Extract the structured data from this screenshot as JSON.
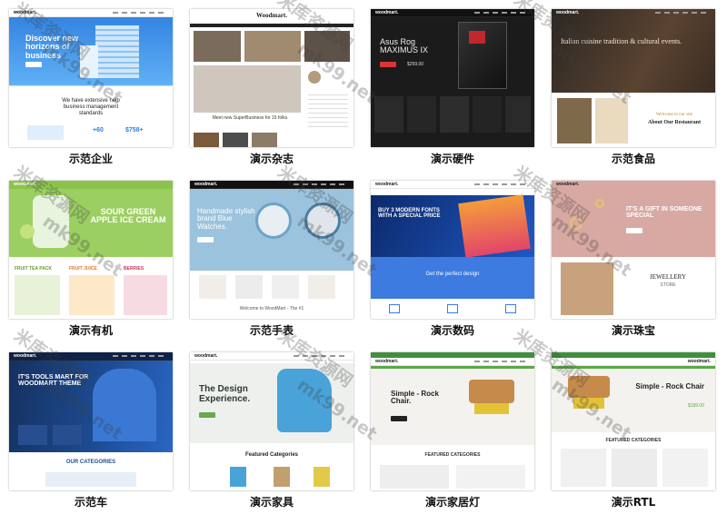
{
  "brand_name": "woodmart.",
  "demos": [
    {
      "caption": "示范企业",
      "hero_title": "Discover new horizons of business",
      "body_line": "We have extensive help business management standards",
      "stats": [
        "+60",
        "$758+"
      ]
    },
    {
      "caption": "演示杂志",
      "hero_title": "Woodmart.",
      "body_line": "Meet new SuperBusiness for 15 folks"
    },
    {
      "caption": "演示硬件",
      "hero_title": "Asus Rog MAXIMUS IX",
      "price": "$299.00"
    },
    {
      "caption": "示范食品",
      "hero_title": "Italian cuisine tradition & cultural events.",
      "sub_title": "Welcome to our site",
      "body_line": "About Our Restaurant"
    },
    {
      "caption": "演示有机",
      "hero_title": "SOUR GREEN APPLE ICE CREAM",
      "products": [
        "FRUIT TEA PACK",
        "FRUIT JUICE",
        "BERRIES"
      ]
    },
    {
      "caption": "示范手表",
      "hero_title": "Handmade stylish brand Blue Watches.",
      "body_line": "Welcome to WoodMart - The #1"
    },
    {
      "caption": "演示数码",
      "hero_title": "BUY 3 MODERN FONTS WITH A SPECIAL PRICE",
      "body_line": "Get the perfect design"
    },
    {
      "caption": "演示珠宝",
      "hero_title": "IT'S A GIFT IN SOMEONE SPECIAL",
      "sub_title": "JEWELLERY",
      "body_line": "STORE"
    },
    {
      "caption": "示范车",
      "hero_title": "IT'S TOOLS MART FOR WOODMART THEME",
      "body_line": "OUR CATEGORIES"
    },
    {
      "caption": "演示家具",
      "hero_title": "The Design Experience.",
      "body_line": "Featured Categories"
    },
    {
      "caption": "演示家居灯",
      "hero_title": "Simple - Rock Chair.",
      "body_line": "FEATURED CATEGORIES"
    },
    {
      "caption": "演示RTL",
      "hero_title": "Simple - Rock Chair",
      "price": "$199.00",
      "body_line": "FEATURED CATEGORIES"
    }
  ],
  "watermarks": [
    "米库资源网",
    "mk99.net"
  ]
}
